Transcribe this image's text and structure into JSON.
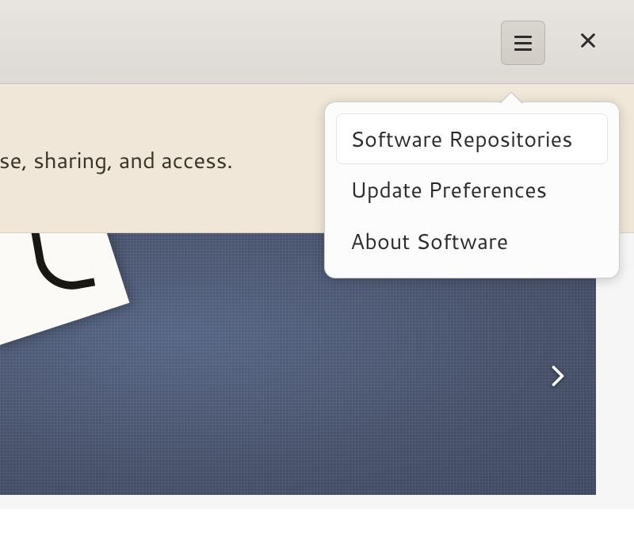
{
  "banner": {
    "text": "…restrictions on use, sharing, and access."
  },
  "menu": {
    "items": [
      {
        "label": "Software Repositories"
      },
      {
        "label": "Update Preferences"
      },
      {
        "label": "About Software"
      }
    ]
  }
}
